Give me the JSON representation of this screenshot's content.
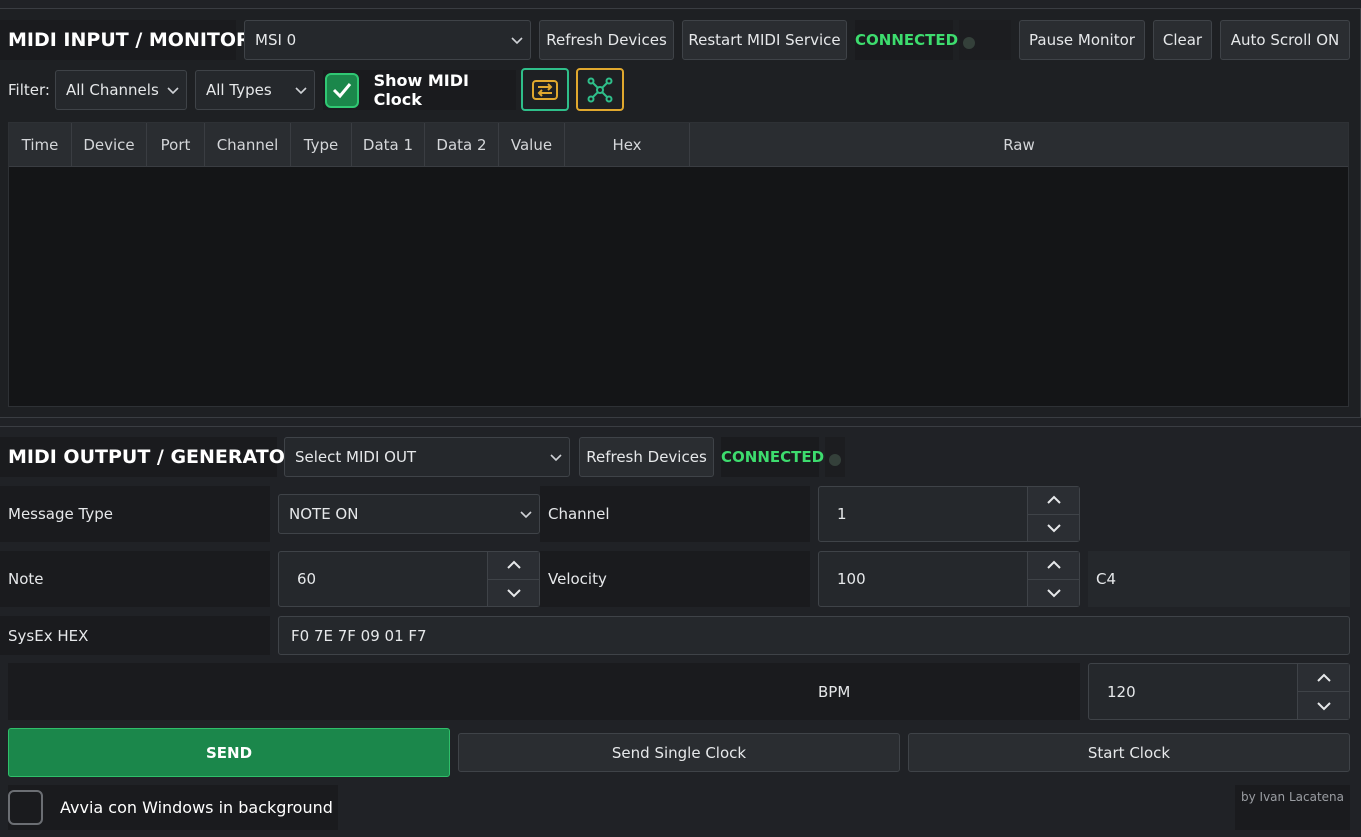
{
  "input": {
    "title": "MIDI INPUT / MONITOR",
    "device_select": "MSI 0",
    "refresh_label": "Refresh Devices",
    "restart_label": "Restart MIDI Service",
    "status": "CONNECTED",
    "pause_label": "Pause Monitor",
    "clear_label": "Clear",
    "autoscroll_label": "Auto Scroll ON",
    "filter_label": "Filter:",
    "channel_filter": "All Channels",
    "type_filter": "All Types",
    "show_clock_label": "Show MIDI Clock",
    "show_clock_checked": true,
    "columns": [
      "Time",
      "Device",
      "Port",
      "Channel",
      "Type",
      "Data 1",
      "Data 2",
      "Value",
      "Hex",
      "Raw"
    ]
  },
  "output": {
    "title": "MIDI OUTPUT / GENERATOR",
    "device_select": "Select MIDI OUT",
    "refresh_label": "Refresh Devices",
    "status": "CONNECTED",
    "message_type_label": "Message Type",
    "message_type_value": "NOTE ON",
    "channel_label": "Channel",
    "channel_value": "1",
    "note_label": "Note",
    "note_value": "60",
    "velocity_label": "Velocity",
    "velocity_value": "100",
    "note_name": "C4",
    "sysex_label": "SysEx HEX",
    "sysex_value": "F0 7E 7F 09 01 F7",
    "bpm_label": "BPM",
    "bpm_value": "120",
    "send_label": "SEND",
    "single_clock_label": "Send Single Clock",
    "start_clock_label": "Start Clock",
    "autostart_label": "Avvia con Windows in background",
    "credit": "by Ivan Lacatena"
  },
  "colors": {
    "status_green": "#3ddc6e",
    "send_green": "#1b874b",
    "icon_green": "#2fbf8a",
    "icon_amber": "#e0a82e"
  }
}
